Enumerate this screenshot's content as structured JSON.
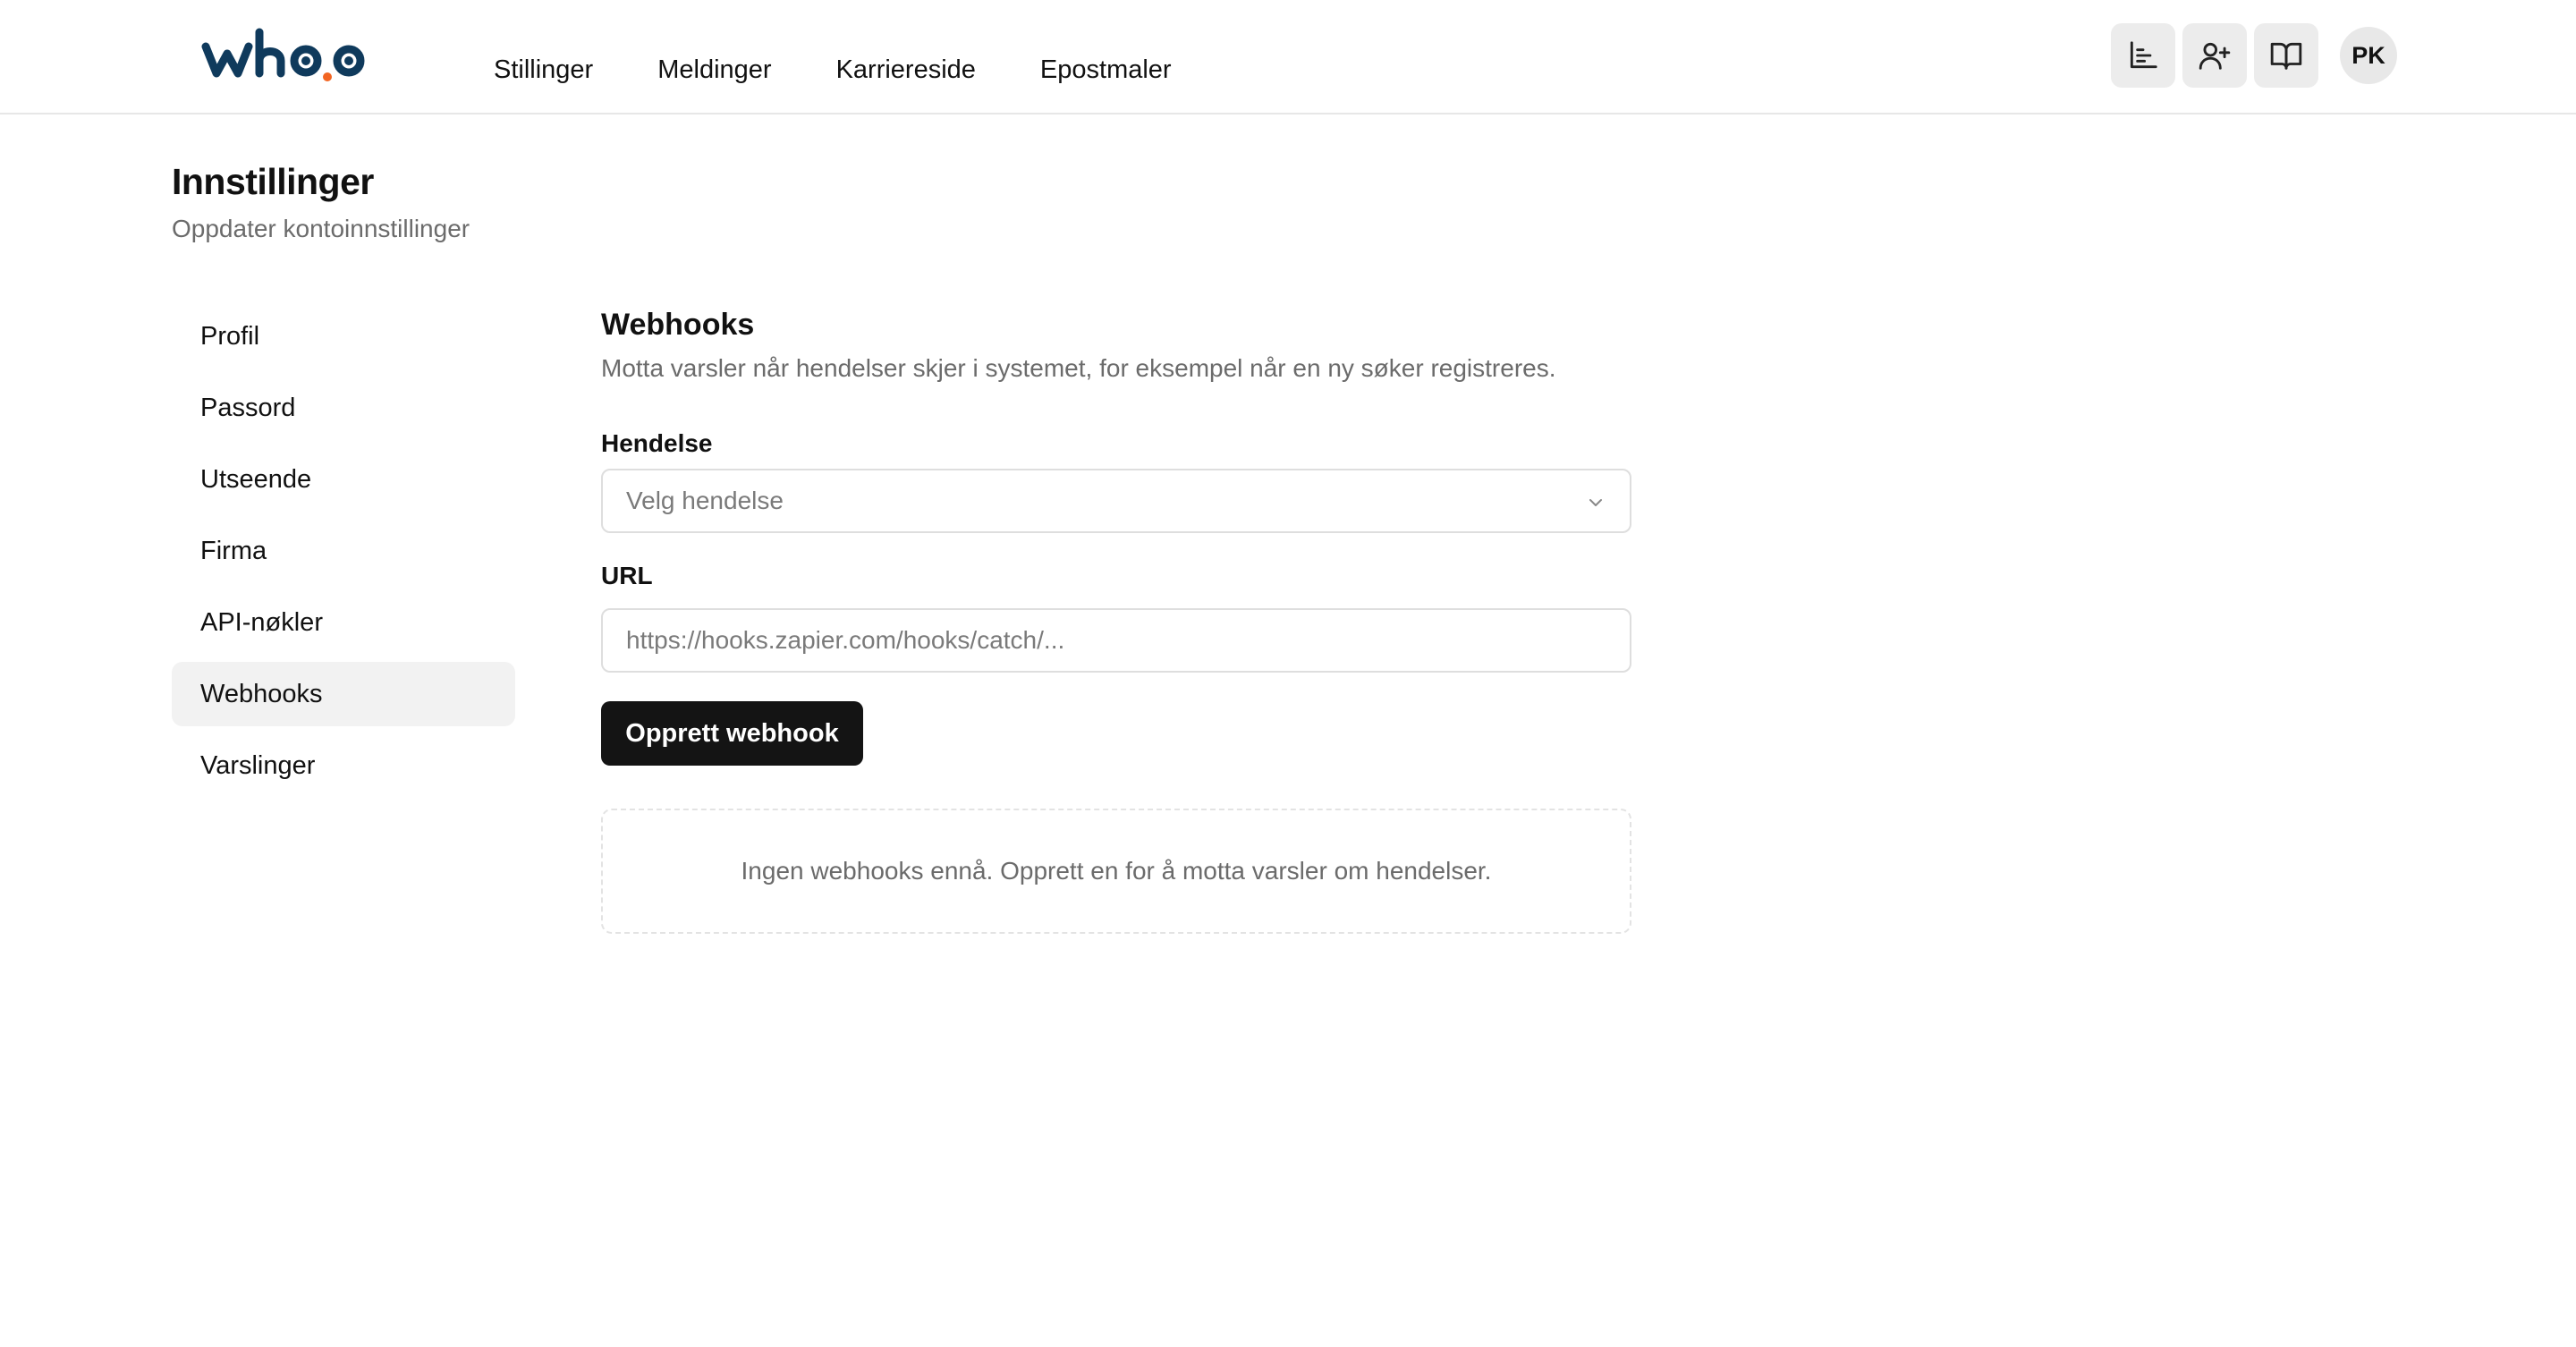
{
  "header": {
    "logo_text": "whoo",
    "nav": [
      "Stillinger",
      "Meldinger",
      "Karriereside",
      "Epostmaler"
    ],
    "icons": [
      "bar-chart-icon",
      "user-plus-icon",
      "book-open-icon"
    ],
    "avatar_initials": "PK"
  },
  "page": {
    "title": "Innstillinger",
    "subtitle": "Oppdater kontoinnstillinger"
  },
  "sidebar": {
    "items": [
      {
        "label": "Profil",
        "active": false
      },
      {
        "label": "Passord",
        "active": false
      },
      {
        "label": "Utseende",
        "active": false
      },
      {
        "label": "Firma",
        "active": false
      },
      {
        "label": "API-nøkler",
        "active": false
      },
      {
        "label": "Webhooks",
        "active": true
      },
      {
        "label": "Varslinger",
        "active": false
      }
    ]
  },
  "webhooks": {
    "title": "Webhooks",
    "description": "Motta varsler når hendelser skjer i systemet, for eksempel når en ny søker registreres.",
    "event_label": "Hendelse",
    "event_placeholder": "Velg hendelse",
    "url_label": "URL",
    "url_placeholder": "https://hooks.zapier.com/hooks/catch/...",
    "url_value": "",
    "create_button": "Opprett webhook",
    "empty_message": "Ingen webhooks ennå. Opprett en for å motta varsler om hendelser."
  },
  "colors": {
    "logo_dark": "#0f3a5c",
    "logo_accent": "#f26522",
    "primary_button": "#141414",
    "active_sidebar": "#f2f2f2",
    "muted_text": "#6b6b6b"
  }
}
